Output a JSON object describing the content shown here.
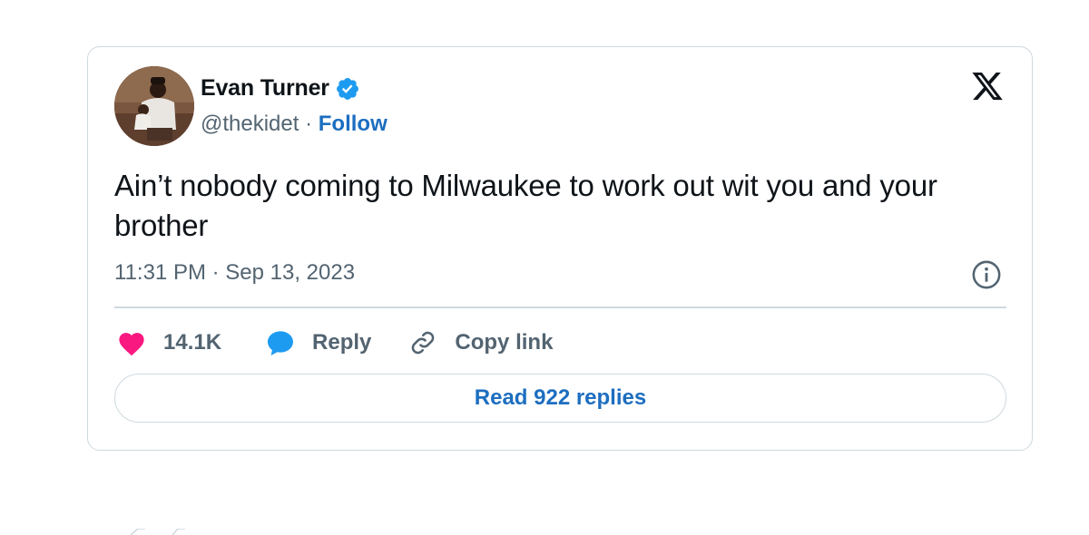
{
  "tweet": {
    "author": {
      "display_name": "Evan Turner",
      "verified_icon": "verified-badge-icon",
      "handle": "@thekidet",
      "separator": " · ",
      "follow_label": "Follow"
    },
    "text": "Ain’t nobody coming to Milwaukee to work out wit you and your brother",
    "timestamp": "11:31 PM · Sep 13, 2023",
    "actions": {
      "like_count": "14.1K",
      "reply_label": "Reply",
      "copy_link_label": "Copy link"
    },
    "read_replies_label": "Read 922 replies"
  },
  "icons": {
    "platform_logo": "x-logo-icon",
    "info": "info-icon",
    "like": "heart-icon",
    "reply": "speech-bubble-icon",
    "copy_link": "link-icon"
  },
  "colors": {
    "link_blue": "#1d6ec0",
    "verified_blue": "#1d9bf0",
    "heart_pink": "#f91880",
    "secondary_text": "#536471",
    "border": "#cfd9de"
  }
}
